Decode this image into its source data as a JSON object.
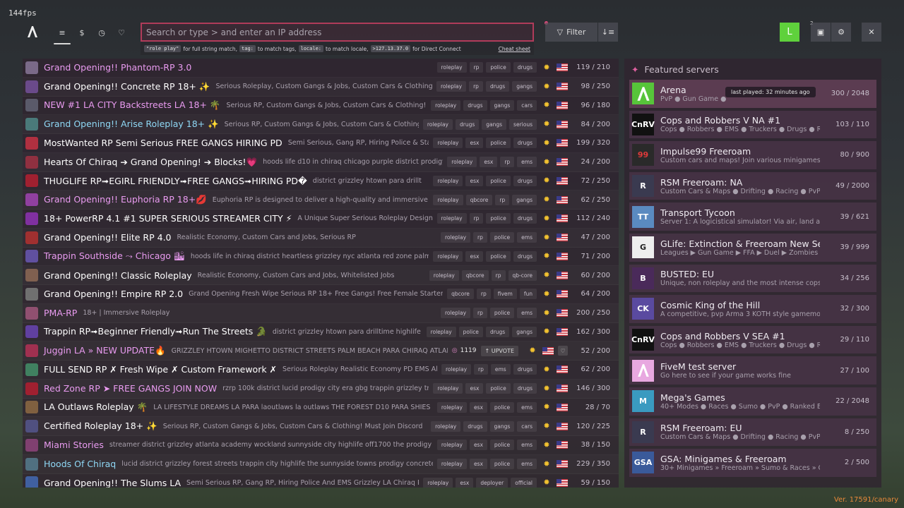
{
  "fps": "144fps",
  "nav": {
    "tabs": [
      {
        "icon": "list-icon",
        "glyph": "≡"
      },
      {
        "icon": "dollar-icon",
        "glyph": "$"
      },
      {
        "icon": "clock-icon",
        "glyph": "◷"
      },
      {
        "icon": "heart-icon",
        "glyph": "♡"
      }
    ]
  },
  "search": {
    "placeholder": "Search or type > and enter an IP address",
    "hints": {
      "code1": "\"role play\"",
      "text1": "for full string match,",
      "code2": "tag:",
      "text2": "to match tags,",
      "code3": "locale:",
      "text3": "to match locale,",
      "code4": ">127.13.37.0",
      "text4": "for Direct Connect",
      "cheat_sheet": "Cheat sheet"
    }
  },
  "toolbar": {
    "filter_label": "Filter",
    "user_initial": "L",
    "notification_count": "2"
  },
  "colors": {
    "accent": "#b03b5a",
    "user": "#5fd13c",
    "boost": "#e08ac8",
    "version": "#e8893a"
  },
  "servers": [
    {
      "name": "Grand Opening!! Phantom-RP 3.0",
      "name_color": "#e99bf0",
      "desc": "",
      "tags": [
        "roleplay",
        "rp",
        "police",
        "drugs"
      ],
      "players": "119 / 210",
      "icon_color": "#7a6a88"
    },
    {
      "name": "Grand Opening!! Concrete RP 18+ ✨",
      "name_color": "#ffffff",
      "desc": "Serious Roleplay, Custom Gangs & Jobs, Custom Cars & Clothing!",
      "tags": [
        "roleplay",
        "rp",
        "drugs",
        "gangs"
      ],
      "players": "98 / 250",
      "icon_color": "#6a4a8a"
    },
    {
      "name": "NEW #1 LA CITY Backstreets LA 18+ 🌴",
      "name_color": "#e99bf0",
      "desc": "Serious RP, Custom Gangs & Jobs, Custom Cars & Clothing! D",
      "tags": [
        "roleplay",
        "drugs",
        "gangs",
        "cars"
      ],
      "players": "96 / 180",
      "icon_color": "#5a5a6a"
    },
    {
      "name": "Grand Opening!! Arise Roleplay 18+ ✨",
      "name_color": "#8fd8f5",
      "desc": "Serious RP, Custom Gangs & Jobs, Custom Cars & Clothing!",
      "tags": [
        "roleplay",
        "drugs",
        "gangs",
        "serious"
      ],
      "players": "84 / 200",
      "icon_color": "#4a7a7a"
    },
    {
      "name": "MostWanted RP Semi Serious FREE GANGS HIRING PD",
      "name_color": "#ffffff",
      "desc": "Semi Serious, Gang RP, Hiring Police & Sta",
      "tags": [
        "roleplay",
        "esx",
        "police",
        "drugs"
      ],
      "players": "199 / 320",
      "icon_color": "#b03040"
    },
    {
      "name": "Hearts Of Chiraq ➔ Grand Opening! ➔ Blocks!💗",
      "name_color": "#ffffff",
      "desc": "hoods life d10 in chiraq chicago purple district prodigy",
      "tags": [
        "roleplay",
        "esx",
        "rp",
        "ems"
      ],
      "players": "24 / 200",
      "icon_color": "#903040"
    },
    {
      "name": "THUGLIFE RP➟EGIRL FRIENDLY➟FREE GANGS➟HIRING PD�",
      "name_color": "#ffffff",
      "desc": "district grizzley htown para drillt",
      "tags": [
        "roleplay",
        "esx",
        "police",
        "drugs"
      ],
      "players": "72 / 250",
      "icon_color": "#a02030"
    },
    {
      "name": "Grand Opening!! Euphoria RP 18+💋",
      "name_color": "#e99bf0",
      "desc": "Euphoria RP is designed to deliver a high-quality and immersive s",
      "tags": [
        "roleplay",
        "qbcore",
        "rp",
        "gangs"
      ],
      "players": "62 / 250",
      "icon_color": "#9040a0"
    },
    {
      "name": "18+ PowerRP 4.1 #1 SUPER SERIOUS STREAMER CITY ⚡",
      "name_color": "#ffffff",
      "desc": "A Unique Super Serious Roleplay Designe",
      "tags": [
        "roleplay",
        "rp",
        "police",
        "drugs"
      ],
      "players": "112 / 240",
      "icon_color": "#8030a0"
    },
    {
      "name": "Grand Opening!! Elite RP 4.0",
      "name_color": "#ffffff",
      "desc": "Realistic Economy, Custom Cars and Jobs, Serious RP",
      "tags": [
        "roleplay",
        "rp",
        "police",
        "ems"
      ],
      "players": "47 / 200",
      "icon_color": "#a03030"
    },
    {
      "name": "Trappin Southside ⤳ Chicago 🏙",
      "name_color": "#e99bf0",
      "desc": "hoods life in chiraq district heartless grizzley nyc atlanta red zone palm",
      "tags": [
        "roleplay",
        "esx",
        "police",
        "drugs"
      ],
      "players": "71 / 200",
      "icon_color": "#6050a0"
    },
    {
      "name": "Grand Opening!! Classic Roleplay",
      "name_color": "#ffffff",
      "desc": "Realistic Economy, Custom Cars and Jobs, Whitelisted Jobs",
      "tags": [
        "roleplay",
        "qbcore",
        "rp",
        "qb-core"
      ],
      "players": "60 / 200",
      "icon_color": "#806050"
    },
    {
      "name": "Grand Opening!! Empire RP 2.0",
      "name_color": "#ffffff",
      "desc": "Grand Opening Fresh Wipe Serious RP 18+ Free Gangs! Free Female Starter P",
      "tags": [
        "qbcore",
        "rp",
        "fivem",
        "fun"
      ],
      "players": "64 / 200",
      "icon_color": "#707070"
    },
    {
      "name": "PMA-RP",
      "name_color": "#e99bf0",
      "desc": "18+ | Immersive Roleplay",
      "tags": [
        "roleplay",
        "rp",
        "police",
        "ems"
      ],
      "players": "200 / 250",
      "icon_color": "#905070"
    },
    {
      "name": "Trappin RP➟Beginner Friendly➟Run The Streets 🐊",
      "name_color": "#ffffff",
      "desc": "district grizzley htown para drilltime highlife",
      "tags": [
        "roleplay",
        "police",
        "drugs",
        "gangs"
      ],
      "players": "162 / 300",
      "icon_color": "#6040a0"
    },
    {
      "name": "Juggin LA » NEW UPDATE🔥",
      "name_color": "#e99bf0",
      "desc": "GRIZZLEY HTOWN MIGHETTO DISTRICT STREETS PALM BEACH PARA CHIRAQ ATLANTA",
      "tags": [],
      "players": "52 / 200",
      "icon_color": "#a03050",
      "boost": "1119",
      "upvote": "UPVOTE",
      "fav": true
    },
    {
      "name": "FULL SEND RP ✗ Fresh Wipe ✗ Custom Framework ✗",
      "name_color": "#ffffff",
      "desc": "Serious Roleplay Realistic Economy PD EMS All",
      "tags": [
        "roleplay",
        "rp",
        "ems",
        "drugs"
      ],
      "players": "62 / 200",
      "icon_color": "#408060"
    },
    {
      "name": "Red Zone RP ➤ FREE GANGS JOIN NOW",
      "name_color": "#e99bf0",
      "desc": "rzrp 100k district lucid prodigy city era gbg trappin grizzley tr",
      "tags": [
        "roleplay",
        "esx",
        "police",
        "drugs"
      ],
      "players": "146 / 300",
      "icon_color": "#a02030"
    },
    {
      "name": "LA Outlaws Roleplay 🌴",
      "name_color": "#ffffff",
      "desc": "LA LIFESTYLE DREAMS LA PARA laoutlaws la outlaws THE FOREST D10 PARA SHIES",
      "tags": [
        "roleplay",
        "esx",
        "police",
        "ems"
      ],
      "players": "28 / 70",
      "icon_color": "#806040"
    },
    {
      "name": "Certified Roleplay 18+ ✨",
      "name_color": "#ffffff",
      "desc": "Serious RP, Custom Gangs & Jobs, Custom Cars & Clothing! Must Join Discord",
      "tags": [
        "roleplay",
        "drugs",
        "gangs",
        "cars"
      ],
      "players": "120 / 225",
      "icon_color": "#505080"
    },
    {
      "name": "Miami Stories",
      "name_color": "#e99bf0",
      "desc": "streamer district grizzley atlanta academy wockland sunnyside city highlife off1700 the prodigy",
      "tags": [
        "roleplay",
        "esx",
        "police",
        "ems"
      ],
      "players": "38 / 150",
      "icon_color": "#804070"
    },
    {
      "name": "Hoods Of Chiraq",
      "name_color": "#8fd8f5",
      "desc": "lucid district grizzley forest streets trappin city highlife the sunnyside towns prodigy concrete",
      "tags": [
        "roleplay",
        "esx",
        "police",
        "ems"
      ],
      "players": "229 / 350",
      "icon_color": "#507080"
    },
    {
      "name": "Grand Opening!! The Slums LA",
      "name_color": "#ffffff",
      "desc": "Semi Serious RP, Gang RP, Hiring Police And EMS Grizzley LA Chiraq P",
      "tags": [
        "roleplay",
        "esx",
        "deployer",
        "official"
      ],
      "players": "59 / 150",
      "icon_color": "#4060a0"
    }
  ],
  "featured": {
    "title": "Featured servers",
    "last_played": "last played: 32 minutes ago",
    "items": [
      {
        "name": "Arena",
        "desc": "PvP ● Gun Game ●",
        "players": "300 / 2048",
        "icon_bg": "#57c43a",
        "icon_text": "",
        "icon": "arena-icon"
      },
      {
        "name": "Cops and Robbers V NA #1",
        "desc": "Cops ● Robbers ● EMS ● Truckers ● Drugs ● Redz",
        "players": "103 / 110",
        "icon_bg": "#111111",
        "icon_text": "CnRV",
        "icon": "cnr-icon"
      },
      {
        "name": "Impulse99 Freeroam",
        "desc": "Custom cars and maps! Join various minigames !",
        "players": "80 / 900",
        "icon_bg": "#2a2a2a",
        "icon_text": "99",
        "icon": "impulse99-icon"
      },
      {
        "name": "RSM Freeroam: NA",
        "desc": "Custom Cars & Maps ● Drifting ● Racing ● PvP ●",
        "players": "49 / 2000",
        "icon_bg": "#3a3a50",
        "icon_text": "R",
        "icon": "rsm-icon"
      },
      {
        "name": "Transport Tycoon",
        "desc": "Server 1: A logicistical simulator! Via air, land and sa",
        "players": "39 / 621",
        "icon_bg": "#5a8ac0",
        "icon_text": "TT",
        "icon": "transport-tycoon-icon"
      },
      {
        "name": "GLife: Extinction & Freeroam New Seas",
        "desc": "Leagues ▶ Gun Game ▶ FFA ▶ Duel ▶ Zombies",
        "players": "39 / 999",
        "icon_bg": "#eeeeee",
        "icon_text": "G",
        "icon": "glife-icon"
      },
      {
        "name": "BUSTED: EU",
        "desc": "Unique, non roleplay and the most intense cops v",
        "players": "34 / 256",
        "icon_bg": "#4a2a5a",
        "icon_text": "B",
        "icon": "busted-icon"
      },
      {
        "name": "Cosmic King of the Hill",
        "desc": "A competitive, pvp Arma 3 KOTH style gamemode",
        "players": "32 / 300",
        "icon_bg": "#5a4aa0",
        "icon_text": "CK",
        "icon": "cosmic-icon"
      },
      {
        "name": "Cops and Robbers V SEA #1",
        "desc": "Cops ● Robbers ● EMS ● Truckers ● Drugs ● Redz",
        "players": "29 / 110",
        "icon_bg": "#111111",
        "icon_text": "CnRV",
        "icon": "cnr-sea-icon"
      },
      {
        "name": "FiveM test server",
        "desc": "Go here to see if your game works fine",
        "players": "27 / 100",
        "icon_bg": "#e8a8e0",
        "icon_text": "",
        "icon": "fivem-icon"
      },
      {
        "name": "Mega's Games",
        "desc": "40+ Modes ● Races ● Sumo ● PvP ● Ranked Eve",
        "players": "22 / 2048",
        "icon_bg": "#3a9ac0",
        "icon_text": "M",
        "icon": "megas-games-icon"
      },
      {
        "name": "RSM Freeroam: EU",
        "desc": "Custom Cars & Maps ● Drifting ● Racing ● PvP ● M",
        "players": "8 / 250",
        "icon_bg": "#3a3a50",
        "icon_text": "R",
        "icon": "rsm-eu-icon"
      },
      {
        "name": "GSA: Minigames & Freeroam",
        "desc": "30+ Minigames » Freeroam » Sumo & Races » Obs",
        "players": "2 / 500",
        "icon_bg": "#3a5a9a",
        "icon_text": "GSA",
        "icon": "gsa-icon"
      }
    ]
  },
  "version": "Ver. 17591/canary"
}
